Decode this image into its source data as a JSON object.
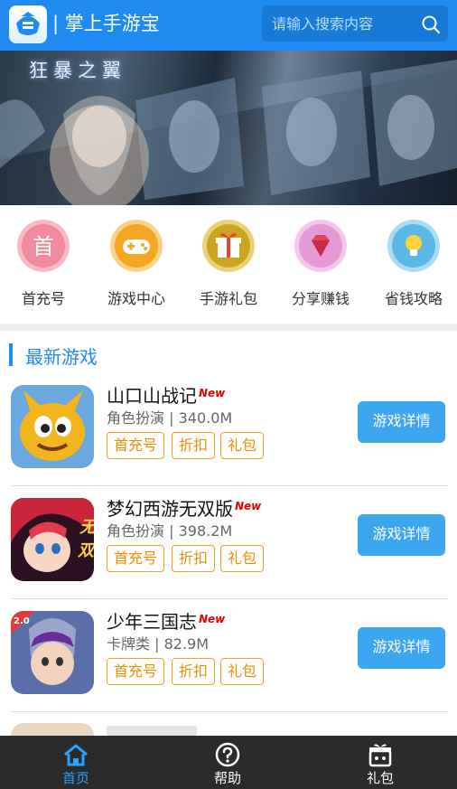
{
  "header": {
    "app_title": "| 掌上手游宝",
    "search_placeholder": "请输入搜索内容",
    "search_icon": "search-icon"
  },
  "banner": {
    "caption": "狂暴之翼"
  },
  "categories": [
    {
      "label": "首充号",
      "glyph": "首",
      "icon": "first-charge-icon",
      "color": "#f28aa0"
    },
    {
      "label": "游戏中心",
      "icon": "gamepad-icon",
      "color": "#f5a623"
    },
    {
      "label": "手游礼包",
      "icon": "gift-icon",
      "color": "#c9a61d"
    },
    {
      "label": "分享赚钱",
      "icon": "diamond-icon",
      "color": "#e59ad8"
    },
    {
      "label": "省钱攻略",
      "icon": "lightbulb-icon",
      "color": "#5ab8e6"
    }
  ],
  "section": {
    "title": "最新游戏"
  },
  "games": [
    {
      "name": "山口山战记",
      "badge": "New",
      "genre": "角色扮演",
      "size": "340.0M",
      "tags": [
        "首充号",
        "折扣",
        "礼包"
      ],
      "button": "游戏详情"
    },
    {
      "name": "梦幻西游无双版",
      "badge": "New",
      "genre": "角色扮演",
      "size": "398.2M",
      "tags": [
        "首充号",
        "折扣",
        "礼包"
      ],
      "button": "游戏详情"
    },
    {
      "name": "少年三国志",
      "badge": "New",
      "genre": "卡牌类",
      "size": "82.9M",
      "tags": [
        "首充号",
        "折扣",
        "礼包"
      ],
      "button": "游戏详情"
    }
  ],
  "bottom_nav": [
    {
      "label": "首页",
      "icon": "home-icon",
      "active": true
    },
    {
      "label": "帮助",
      "icon": "help-icon",
      "active": false
    },
    {
      "label": "礼包",
      "icon": "gift-box-icon",
      "active": false
    }
  ],
  "colors": {
    "primary": "#1f8bf0",
    "button": "#3da6f0",
    "tag": "#f08c00",
    "nav_bg": "#2b2b2b",
    "nav_active": "#2aa0ff"
  }
}
